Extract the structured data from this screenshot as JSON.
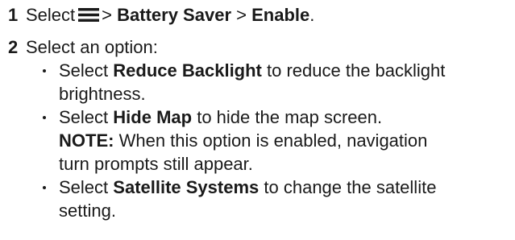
{
  "step1": {
    "number": "1",
    "select": "Select",
    "icon": "menu-icon",
    "sep1": ">",
    "item1": "Battery Saver",
    "sep2": ">",
    "item2": "Enable",
    "end": "."
  },
  "step2": {
    "number": "2",
    "text": "Select an option:"
  },
  "bullets": [
    {
      "select": "Select",
      "bold": "Reduce Backlight",
      "rest_line1": "to reduce the backlight",
      "line2": "brightness."
    },
    {
      "select": "Select",
      "bold": "Hide Map",
      "rest": "to hide the map screen.",
      "note_label": "NOTE:",
      "note_line1": "When this option is enabled, navigation",
      "note_line2": "turn prompts still appear."
    },
    {
      "select": "Select",
      "bold": "Satellite Systems",
      "rest_line1": "to change the satellite",
      "line2": "setting."
    }
  ]
}
